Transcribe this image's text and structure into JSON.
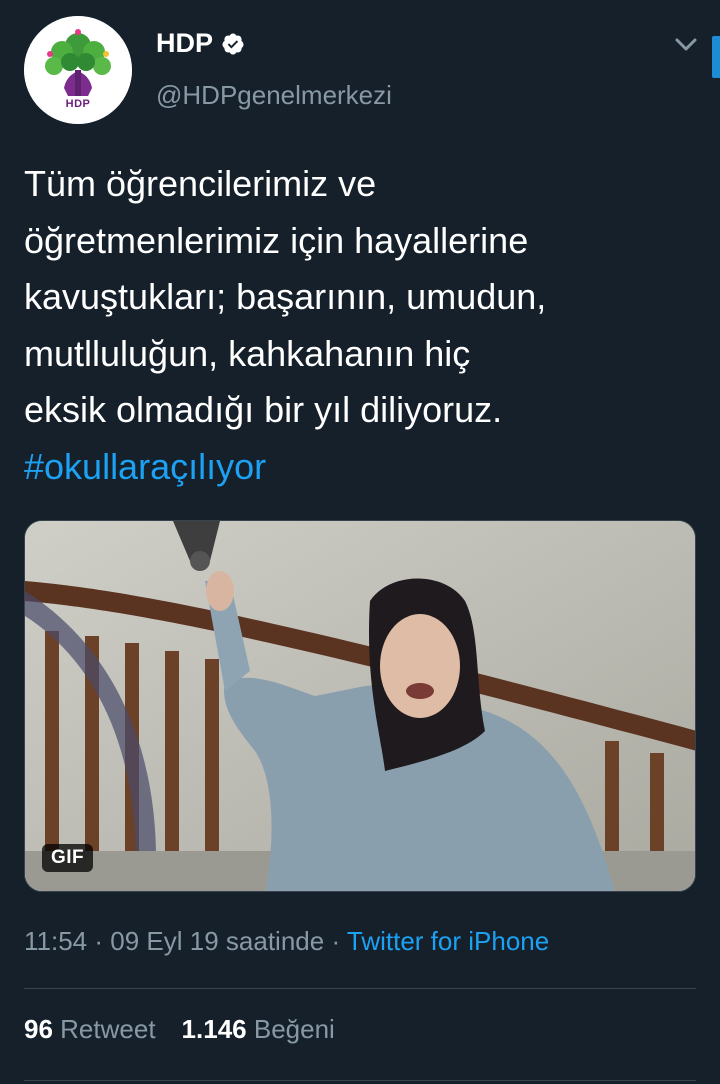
{
  "account": {
    "display_name": "HDP",
    "handle": "@HDPgenelmerkezi",
    "avatar_label": "HDP",
    "verified": true
  },
  "tweet": {
    "text": "Tüm öğrencilerimiz ve\nöğretmenlerimiz için hayallerine\nkavuştukları; başarının, umudun,\nmutlluluğun, kahkahanın hiç\neksik olmadığı bir yıl diliyoruz.",
    "hashtag": "#okullaraçılıyor"
  },
  "media": {
    "badge": "GIF"
  },
  "meta": {
    "time": "11:54",
    "separator1": "·",
    "date": "09 Eyl 19 saatinde",
    "separator2": "·",
    "source": "Twitter for iPhone"
  },
  "stats": {
    "retweets_count": "96",
    "retweets_label": "Retweet",
    "likes_count": "1.146",
    "likes_label": "Beğeni"
  },
  "colors": {
    "background": "#15202b",
    "primary_text": "#ffffff",
    "secondary_text": "#8899a6",
    "accent": "#1da1f2",
    "divider": "#38444d"
  },
  "icons": {
    "verified": "verified-badge-icon",
    "menu": "chevron-down-icon"
  }
}
